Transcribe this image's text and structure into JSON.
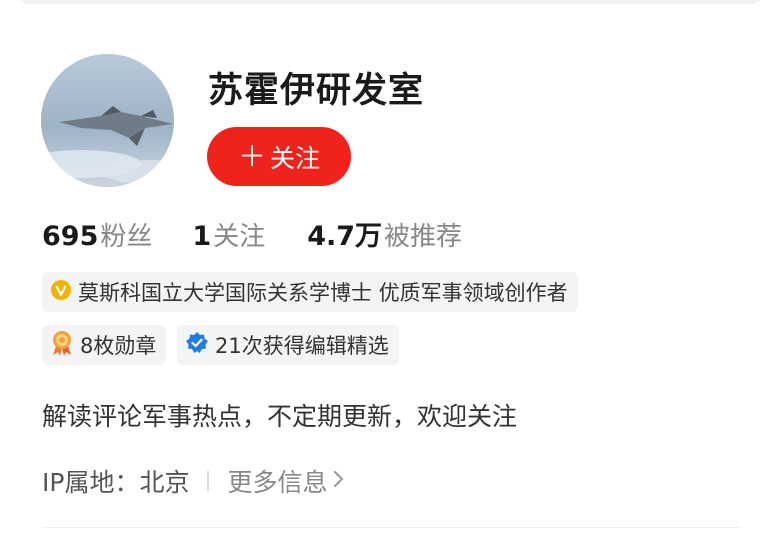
{
  "profile": {
    "name": "苏霍伊研发室",
    "avatar_icon": "fighter-jet-photo",
    "follow_label": "关注",
    "follow_plus": "＋"
  },
  "stats": [
    {
      "value": "695",
      "label": "粉丝"
    },
    {
      "value": "1",
      "label": "关注"
    },
    {
      "value": "4.7万",
      "label": "被推荐"
    }
  ],
  "badges": {
    "verified_text": "莫斯科国立大学国际关系学博士 优质军事领域创作者",
    "verified_icon": "v-badge-icon",
    "medals_text": "8枚勋章",
    "medals_icon": "medal-icon",
    "featured_text": "21次获得编辑精选",
    "featured_icon": "check-badge-icon"
  },
  "bio": "解读评论军事热点，不定期更新，欢迎关注",
  "ip": {
    "label": "IP属地：",
    "value": "北京",
    "more_label": "更多信息"
  },
  "colors": {
    "accent": "#f0221c",
    "chip_bg": "#f3f4f6",
    "verified_gold": "#f0b400",
    "featured_blue": "#1f7ee0"
  }
}
